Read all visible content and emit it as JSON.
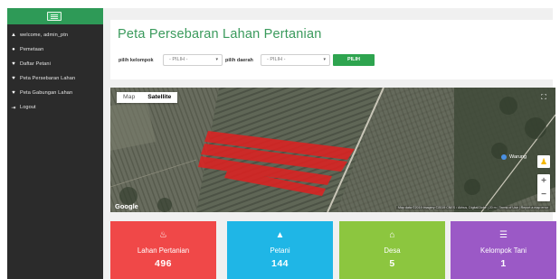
{
  "sidebar": {
    "items": [
      {
        "icon": "user-icon",
        "glyph": "▲",
        "label": "welcome, admin_ptn"
      },
      {
        "icon": "users-icon",
        "glyph": "●",
        "label": "Pemetaan"
      },
      {
        "icon": "map-marker-icon",
        "glyph": "♥",
        "label": "Daftar Petani"
      },
      {
        "icon": "map-marker-icon",
        "glyph": "♥",
        "label": "Peta Persebaran Lahan"
      },
      {
        "icon": "map-marker-icon",
        "glyph": "♥",
        "label": "Peta Gabungan Lahan"
      },
      {
        "icon": "logout-icon",
        "glyph": "⇥",
        "label": "Logout"
      }
    ]
  },
  "header": {
    "title": "Peta Persebaran Lahan Pertanian"
  },
  "filters": {
    "kelompok_label": "pilih kelompok",
    "kelompok_value": "- PILIH -",
    "daerah_label": "pilih daerah",
    "daerah_value": "- PILIH -",
    "button_label": "PILIH"
  },
  "map": {
    "tabs": [
      {
        "label": "Map",
        "active": false
      },
      {
        "label": "Satellite",
        "active": true
      }
    ],
    "place_label": "Warung",
    "logo": "Google",
    "attribution": "Map data ©2019 Imagery ©2019 CNES / Airbus, DigitalGlobe | 20 m | Terms of Use | Report a map error",
    "zoom_in": "+",
    "zoom_out": "−",
    "fullscreen": "⛶"
  },
  "stats": [
    {
      "label": "Lahan Pertanian",
      "value": "496",
      "color": "#f04848",
      "icon": "seedling-icon",
      "glyph": "♨"
    },
    {
      "label": "Petani",
      "value": "144",
      "color": "#1fb6e6",
      "icon": "user-icon",
      "glyph": "▲"
    },
    {
      "label": "Desa",
      "value": "5",
      "color": "#8cc63f",
      "icon": "home-icon",
      "glyph": "⌂"
    },
    {
      "label": "Kelompok Tani",
      "value": "1",
      "color": "#9b59c6",
      "icon": "list-icon",
      "glyph": "☰"
    }
  ]
}
